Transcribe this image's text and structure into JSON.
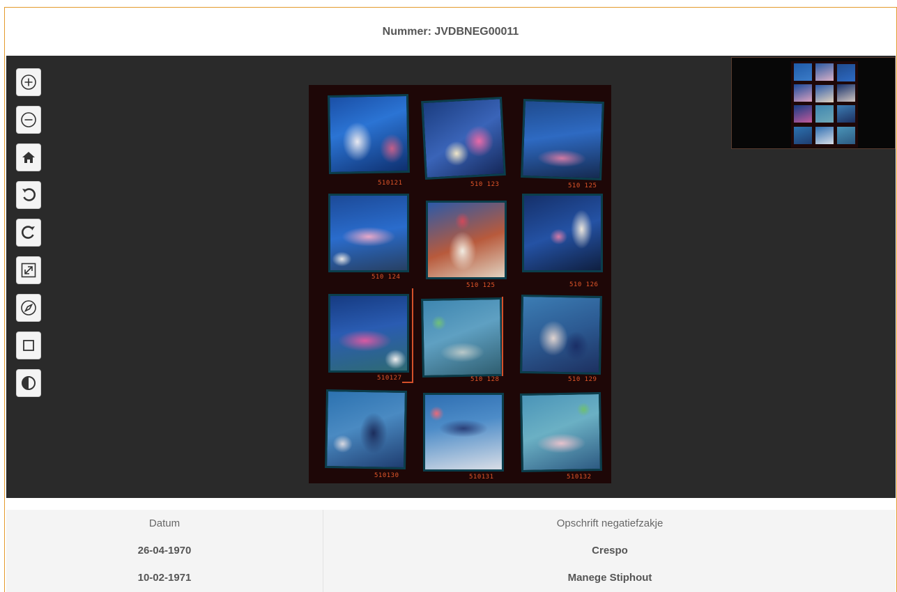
{
  "header": {
    "title": "Nummer: JVDBNEG00011"
  },
  "toolbar": {
    "buttons": [
      {
        "name": "zoom-in-button",
        "icon": "zoom-in-icon"
      },
      {
        "name": "zoom-out-button",
        "icon": "zoom-out-icon"
      },
      {
        "name": "home-button",
        "icon": "home-icon"
      },
      {
        "name": "rotate-left-button",
        "icon": "rotate-left-icon"
      },
      {
        "name": "rotate-right-button",
        "icon": "rotate-right-icon"
      },
      {
        "name": "fullscreen-button",
        "icon": "fullscreen-icon"
      },
      {
        "name": "compass-button",
        "icon": "compass-icon"
      },
      {
        "name": "square-button",
        "icon": "square-icon"
      },
      {
        "name": "contrast-button",
        "icon": "contrast-icon"
      }
    ]
  },
  "contact_sheet": {
    "frames": [
      {
        "label": "510121"
      },
      {
        "label": "510 123"
      },
      {
        "label": "510 125"
      },
      {
        "label": "510 124"
      },
      {
        "label": "510 125"
      },
      {
        "label": "510 126"
      },
      {
        "label": "510127"
      },
      {
        "label": "510 128"
      },
      {
        "label": "510 129"
      },
      {
        "label": "510130"
      },
      {
        "label": "510131"
      },
      {
        "label": "510132"
      }
    ]
  },
  "info": {
    "left_header": "Datum",
    "left_values": [
      "26-04-1970",
      "10-02-1971"
    ],
    "right_header": "Opschrift negatiefzakje",
    "right_values": [
      "Crespo",
      "Manege Stiphout"
    ]
  },
  "colors": {
    "accent_border": "#e39a2c",
    "viewer_bg": "#2a2a2a",
    "negative_sheet": "#1e0707",
    "frame_label": "#e2562a"
  }
}
